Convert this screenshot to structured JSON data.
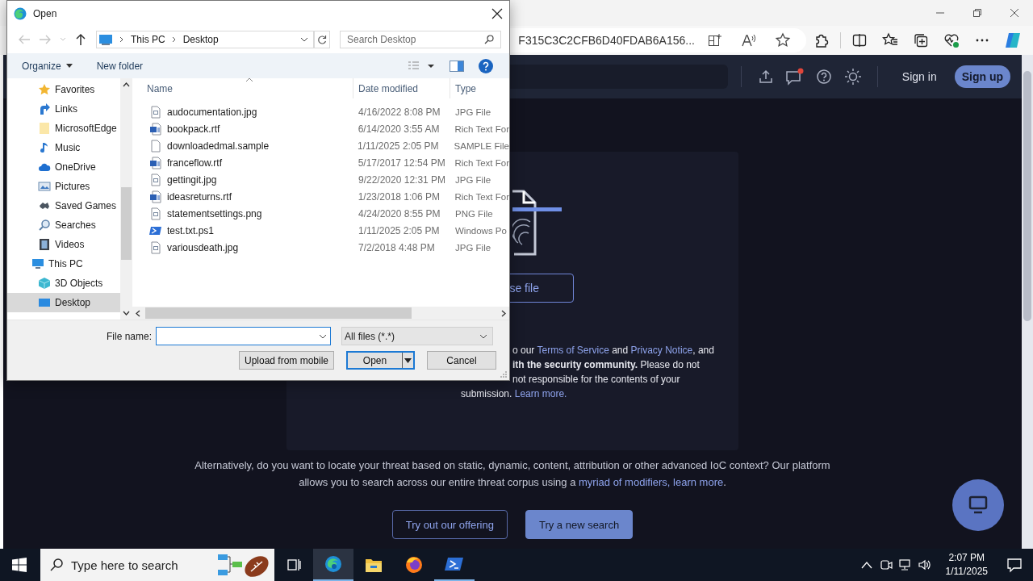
{
  "browser": {
    "url": "F315C3C2CFB6D40FDAB6A156..."
  },
  "site_header": {
    "messages_unread": true,
    "sign_in": "Sign in",
    "sign_up": "Sign up"
  },
  "upload_card": {
    "choose_file": "se file",
    "disclaimer_lines": [
      {
        "parts": [
          {
            "kind": "text",
            "text": "o our "
          },
          {
            "kind": "link",
            "text": "Terms of Service"
          },
          {
            "kind": "text",
            "text": " and "
          },
          {
            "kind": "link",
            "text": "Privacy Notice"
          },
          {
            "kind": "text",
            "text": ", and"
          }
        ]
      },
      {
        "parts": [
          {
            "kind": "text",
            "text": "**ith the security community.** Please do not"
          }
        ]
      },
      {
        "parts": [
          {
            "kind": "text",
            "text": "not responsible for the contents of your"
          }
        ]
      },
      {
        "parts": [
          {
            "kind": "text",
            "text": "submission. "
          },
          {
            "kind": "link",
            "text": "Learn more."
          }
        ]
      }
    ]
  },
  "search_hint": {
    "line_1": "Alternatively, do you want to locate your threat based on static, dynamic, content, attribution or other advanced IoC context? Our platform",
    "line_2_before": "allows you to search across our entire threat corpus using a ",
    "line_2_link": "myriad of modifiers, learn more",
    "line_2_after": "."
  },
  "actions": [
    {
      "kind": "outline",
      "label": "Try out our offering"
    },
    {
      "kind": "filled",
      "label": "Try a new search"
    }
  ],
  "dialog": {
    "title": "Open",
    "back_disabled": true,
    "forward_disabled": true,
    "breadcrumb": [
      "This PC",
      "Desktop"
    ],
    "search_placeholder": "Search Desktop",
    "organize": "Organize",
    "new_folder": "New folder",
    "nav_tree": [
      {
        "children": [
          {
            "label": "Favorites",
            "selected": false
          },
          {
            "label": "Links",
            "selected": false
          },
          {
            "label": "MicrosoftEdge",
            "selected": false
          },
          {
            "label": "Music",
            "selected": false
          },
          {
            "label": "OneDrive",
            "selected": false
          },
          {
            "label": "Pictures",
            "selected": false
          },
          {
            "label": "Saved Games",
            "selected": false
          },
          {
            "label": "Searches",
            "selected": false
          },
          {
            "label": "Videos",
            "selected": false
          }
        ]
      },
      {
        "label": "This PC",
        "selected": false,
        "children": [
          {
            "label": "3D Objects",
            "selected": false
          },
          {
            "label": "Desktop",
            "selected": true
          }
        ]
      }
    ],
    "columns": [
      "Name",
      "Date modified",
      "Type"
    ],
    "files": [
      {
        "name": "audocumentation.jpg",
        "date": "4/16/2022 8:08 PM",
        "type": "JPG File",
        "kind": "image",
        "selected": false
      },
      {
        "name": "bookpack.rtf",
        "date": "6/14/2020 3:55 AM",
        "type": "Rich Text For",
        "kind": "word",
        "selected": false
      },
      {
        "name": "downloadedmal.sample",
        "date": "1/11/2025 2:05 PM",
        "type": "SAMPLE File",
        "kind": "blank",
        "selected": false
      },
      {
        "name": "franceflow.rtf",
        "date": "5/17/2017 12:54 PM",
        "type": "Rich Text For",
        "kind": "word",
        "selected": false
      },
      {
        "name": "gettingit.jpg",
        "date": "9/22/2020 12:31 PM",
        "type": "JPG File",
        "kind": "image",
        "selected": false
      },
      {
        "name": "ideasreturns.rtf",
        "date": "1/23/2018 1:06 PM",
        "type": "Rich Text For",
        "kind": "word",
        "selected": false
      },
      {
        "name": "statementsettings.png",
        "date": "4/24/2020 8:55 PM",
        "type": "PNG File",
        "kind": "image",
        "selected": false
      },
      {
        "name": "test.txt.ps1",
        "date": "1/11/2025 2:05 PM",
        "type": "Windows Po",
        "kind": "script",
        "selected": false
      },
      {
        "name": "variousdeath.jpg",
        "date": "7/2/2018 4:48 PM",
        "type": "JPG File",
        "kind": "image",
        "selected": false
      }
    ],
    "file_name_label": "File name:",
    "file_type": "All files (*.*)",
    "buttons": [
      {
        "kind": "plain",
        "label": "Upload from mobile"
      },
      {
        "kind": "split",
        "label": "Open"
      },
      {
        "kind": "plain",
        "label": "Cancel"
      }
    ]
  },
  "taskbar": {
    "search_placeholder": "Type here to search",
    "apps": [
      {
        "selected": true,
        "running": true
      },
      {
        "selected": false,
        "running": false
      },
      {
        "selected": false,
        "running": false
      },
      {
        "selected": false,
        "running": true
      }
    ],
    "time": "2:07 PM",
    "date": "1/11/2025"
  }
}
